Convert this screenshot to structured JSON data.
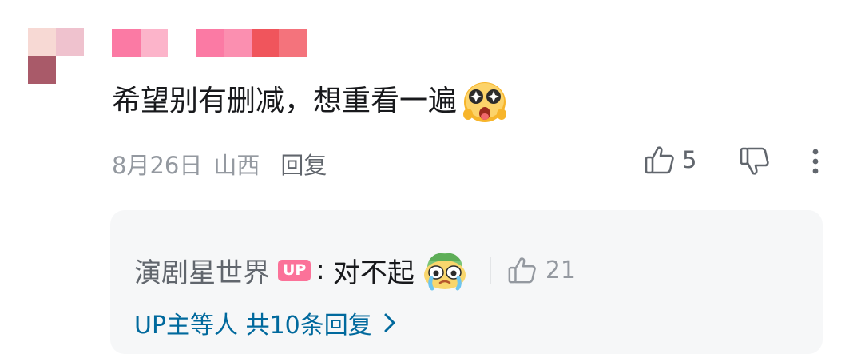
{
  "comment": {
    "text": "希望别有删减，想重看一遍",
    "emoji": "amazed-emoji",
    "date": "8月26日",
    "location": "山西",
    "reply_label": "回复",
    "like_count": "5",
    "icons": {
      "like": "thumbs-up-icon",
      "dislike": "thumbs-down-icon",
      "more": "more-vertical-icon"
    }
  },
  "sub_reply": {
    "author": "演剧星世界",
    "badge": "UP",
    "colon": ":",
    "text": "对不起",
    "emoji": "sorry-crying-emoji",
    "like_count": "21"
  },
  "view_more": {
    "label": "UP主等人 共10条回复"
  },
  "colors": {
    "text_primary": "#18191c",
    "text_secondary": "#9499a0",
    "link": "#00699d",
    "up_badge": "#fb7299",
    "reply_bg": "#f6f7f8"
  }
}
